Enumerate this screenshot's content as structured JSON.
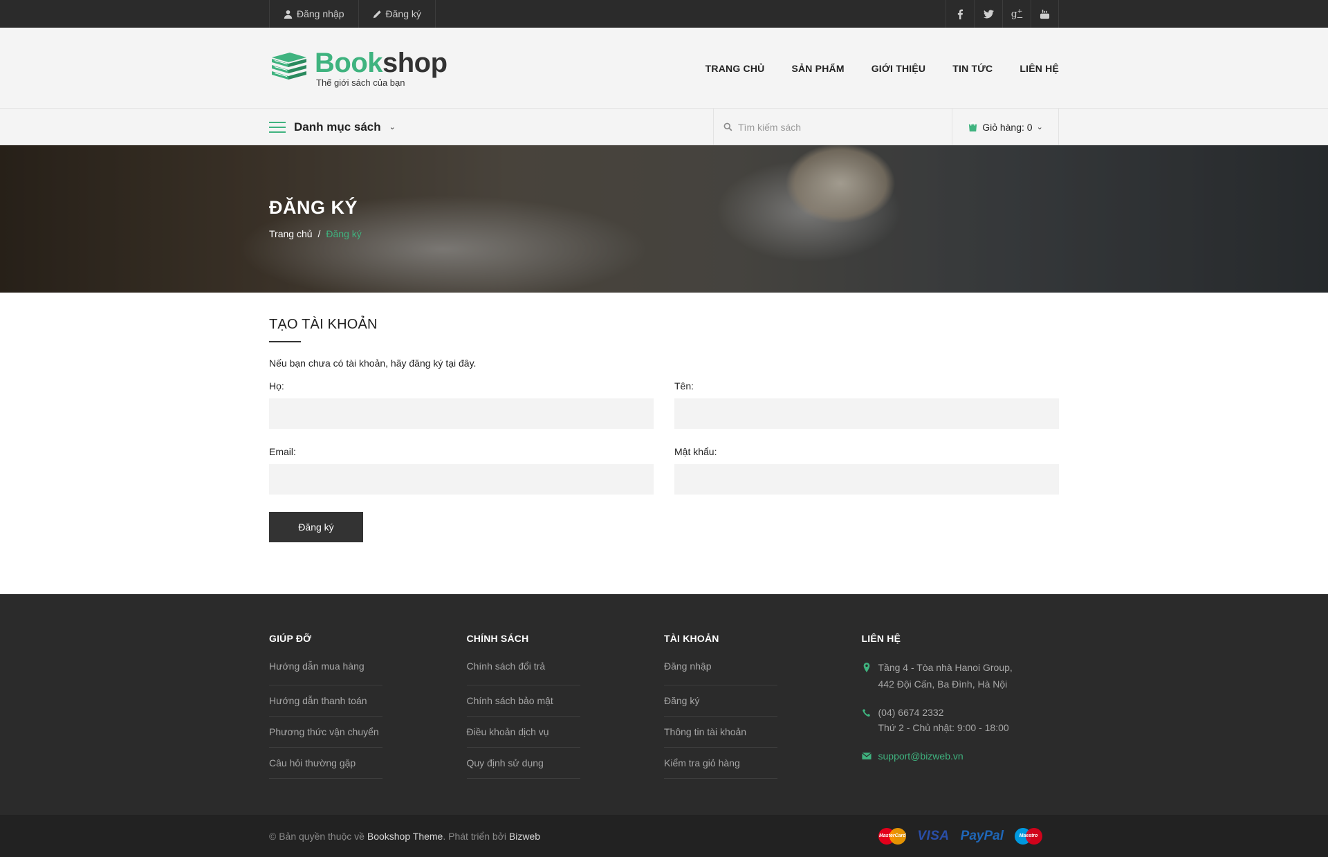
{
  "topbar": {
    "login": "Đăng nhập",
    "register": "Đăng ký",
    "social": [
      "facebook-icon",
      "twitter-icon",
      "google-plus-icon",
      "youtube-icon"
    ]
  },
  "brand": {
    "name_green": "Book",
    "name_dark": "shop",
    "tagline": "Thế giới sách của bạn",
    "accent": "#3fb37f"
  },
  "nav": {
    "items": [
      "TRANG CHỦ",
      "SẢN PHẨM",
      "GIỚI THIỆU",
      "TIN TỨC",
      "LIÊN HỆ"
    ]
  },
  "catbar": {
    "menu_label": "Danh mục sách",
    "search_placeholder": "Tìm kiếm sách",
    "cart_label": "Giỏ hàng: 0"
  },
  "banner": {
    "title": "ĐĂNG KÝ",
    "breadcrumb": [
      "Trang chủ",
      "/",
      "Đăng ký"
    ]
  },
  "form": {
    "title": "TẠO TÀI KHOẢN",
    "intro": "Nếu bạn chưa có tài khoản, hãy đăng ký tại đây.",
    "last_name_label": "Họ:",
    "first_name_label": "Tên:",
    "email_label": "Email:",
    "password_label": "Mật khẩu:",
    "submit": "Đăng ký"
  },
  "footer": {
    "cols": [
      {
        "title": "GIÚP ĐỠ",
        "links": [
          "Hướng dẫn mua hàng",
          "Hướng dẫn thanh toán",
          "Phương thức vận chuyển",
          "Câu hỏi thường gặp"
        ]
      },
      {
        "title": "CHÍNH SÁCH",
        "links": [
          "Chính sách đổi trả",
          "Chính sách bảo mật",
          "Điều khoản dịch vụ",
          "Quy định sử dụng"
        ]
      },
      {
        "title": "TÀI KHOẢN",
        "links": [
          "Đăng nhập",
          "Đăng ký",
          "Thông tin tài khoản",
          "Kiểm tra giỏ hàng"
        ]
      }
    ],
    "contact": {
      "title": "LIÊN HỆ",
      "address_line1": "Tầng 4 - Tòa nhà Hanoi Group,",
      "address_line2": "442 Đội Cấn, Ba Đình, Hà Nội",
      "phone": "(04) 6674 2332",
      "hours": "Thứ 2 - Chủ nhật: 9:00 - 18:00",
      "email": "support@bizweb.vn"
    }
  },
  "bottom": {
    "copyright_prefix": "© Bản quyền thuộc về",
    "theme_name": "Bookshop Theme",
    "developed_by": ". Phát triển bởi",
    "developer": "Bizweb",
    "payments": {
      "mastercard": "MasterCard",
      "visa": "VISA",
      "paypal": "PayPal",
      "maestro": "Maestro"
    }
  }
}
